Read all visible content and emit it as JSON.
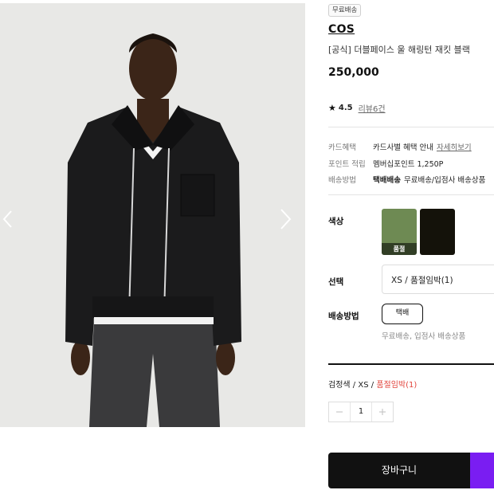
{
  "product": {
    "shipping_badge": "무료배송",
    "brand": "COS",
    "name": "[공식] 더블페이스 울 해링턴 재킷 블랙",
    "price": "250,000",
    "rating": "4.5",
    "reviews": "리뷰6건"
  },
  "benefits": [
    {
      "key": "카드혜택",
      "value": "카드사별 혜택 안내",
      "link": "자세히보기"
    },
    {
      "key": "포인트 적립",
      "value": "멤버십포인트 1,250P"
    },
    {
      "key": "배송방법",
      "strong": "택배배송",
      "value": "무료배송/입점사 배송상품"
    }
  ],
  "options": {
    "color_label": "색상",
    "colors": [
      {
        "name": "green",
        "hex": "#6e8a53",
        "status": "품절"
      },
      {
        "name": "black",
        "hex": "#14120a"
      }
    ],
    "select_label": "선택",
    "selected_size": "XS / 품절임박(1)",
    "shipping_label": "배송방법",
    "shipping_option": "택배",
    "shipping_note": "무료배송, 입점사 배송상품"
  },
  "selection": {
    "color": "검정색",
    "size": "XS",
    "stock": "품절임박(1)",
    "quantity": "1"
  },
  "actions": {
    "cart": "장바구니"
  },
  "colors": {
    "accent": "#7a1df2",
    "warning": "#e2433b"
  }
}
